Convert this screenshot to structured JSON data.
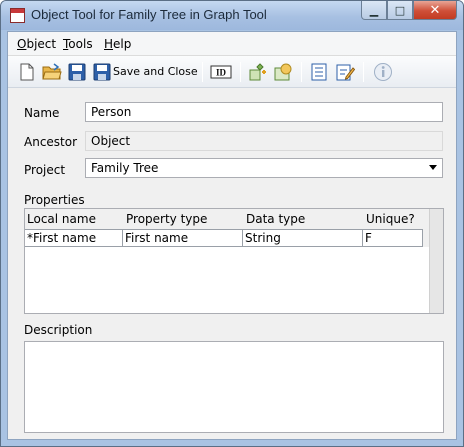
{
  "window": {
    "title": "Object Tool for Family Tree in Graph Tool",
    "minimize_glyph": "▁",
    "maximize_glyph": "□",
    "close_glyph": "✕"
  },
  "menu": {
    "items": [
      {
        "label_first": "O",
        "label_rest": "bject"
      },
      {
        "label_first": "T",
        "label_rest": "ools"
      },
      {
        "label_first": "H",
        "label_rest": "elp"
      }
    ]
  },
  "toolbar": {
    "save_close_label": "Save and Close",
    "id_label": "ID",
    "icons": [
      "new-document-icon",
      "open-folder-icon",
      "save-icon",
      "save-and-close-icon",
      "id-icon",
      "graph-add-icon",
      "graph-edit-icon",
      "list-icon",
      "edit-notes-icon",
      "info-icon"
    ]
  },
  "form": {
    "name_label": "Name",
    "name_value": "Person",
    "ancestor_label": "Ancestor",
    "ancestor_value": "Object",
    "project_label": "Project",
    "project_value": "Family Tree"
  },
  "properties": {
    "section_label": "Properties",
    "columns": [
      "Local name",
      "Property type",
      "Data type",
      "Unique?"
    ],
    "rows": [
      [
        "*First name",
        "First name",
        "String",
        "F"
      ]
    ]
  },
  "description": {
    "section_label": "Description",
    "value": ""
  },
  "colors": {
    "titlebar": "#a7c0e2",
    "close_button": "#c23b22",
    "client_background": "#f0f0f0"
  }
}
